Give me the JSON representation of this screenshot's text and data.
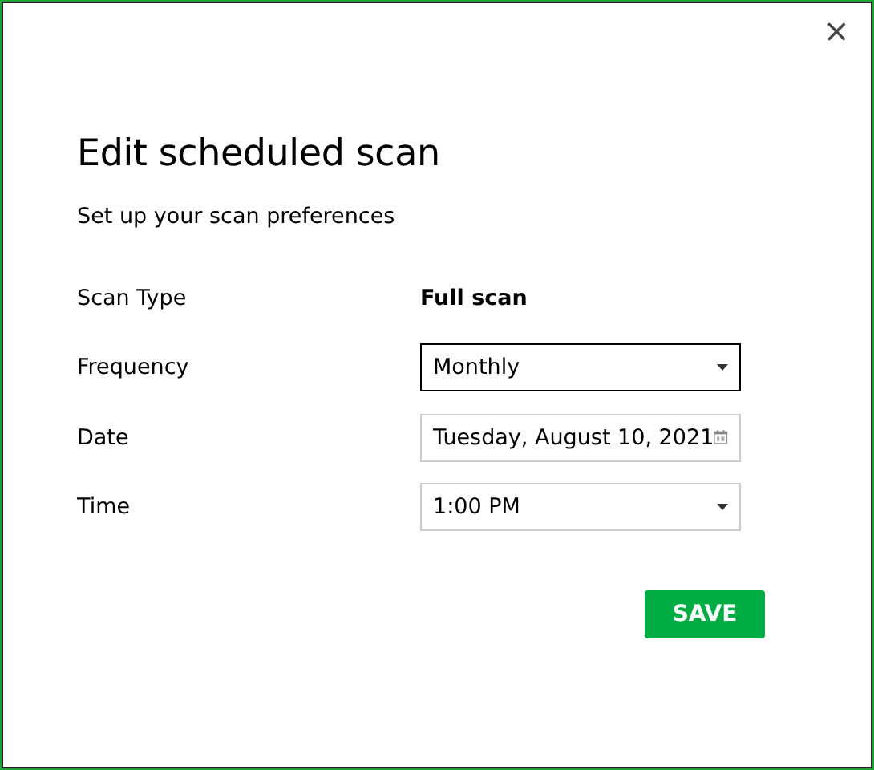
{
  "dialog": {
    "title": "Edit scheduled scan",
    "subtitle": "Set up your scan preferences",
    "close": "×"
  },
  "fields": [
    {
      "kind": "static",
      "label": "Scan Type",
      "value": "Full scan"
    },
    {
      "kind": "select",
      "label": "Frequency",
      "value": "Monthly",
      "focused": true
    },
    {
      "kind": "date",
      "label": "Date",
      "value": "Tuesday, August 10, 2021",
      "focused": false
    },
    {
      "kind": "select",
      "label": "Time",
      "value": "1:00 PM",
      "focused": false
    }
  ],
  "save_button": "SAVE"
}
